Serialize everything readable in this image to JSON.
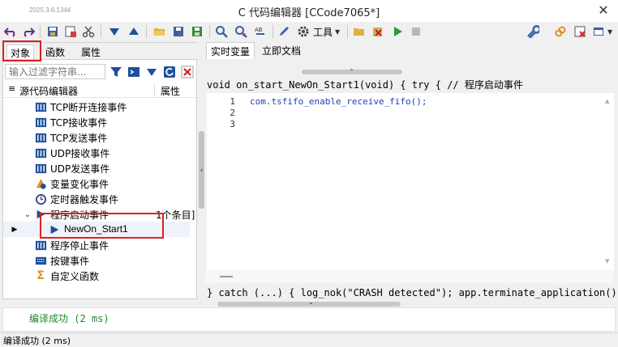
{
  "window": {
    "version": "2025.3.6.1344",
    "title": "C 代码编辑器 [CCode7065*]",
    "close_glyph": "✕"
  },
  "toolbar": {
    "tools_label": "工具",
    "icons": [
      "undo-icon",
      "redo-icon",
      "save-icon",
      "save-as-icon",
      "cut-icon",
      "move-down-icon",
      "move-up-icon",
      "open-folder-icon",
      "export-icon",
      "import-icon",
      "search-icon",
      "replace-icon",
      "format-icon",
      "pen-icon",
      "gear-icon",
      "tools-menu",
      "new-folder-icon",
      "delete-icon",
      "run-icon",
      "stop-icon",
      "wrench-icon",
      "link-icon",
      "close-doc-icon",
      "window-menu"
    ]
  },
  "left_panel": {
    "tabs": [
      "对象",
      "函数",
      "属性"
    ],
    "filter_placeholder": "输入过滤字符串...",
    "tree_header": {
      "name": "源代码编辑器",
      "property": "属性"
    },
    "items": [
      {
        "label": "TCP断开连接事件",
        "icon": "grid-icon"
      },
      {
        "label": "TCP接收事件",
        "icon": "grid-icon"
      },
      {
        "label": "TCP发送事件",
        "icon": "grid-icon"
      },
      {
        "label": "UDP接收事件",
        "icon": "grid-icon"
      },
      {
        "label": "UDP发送事件",
        "icon": "grid-icon"
      },
      {
        "label": "变量变化事件",
        "icon": "variable-icon"
      },
      {
        "label": "定时器触发事件",
        "icon": "clock-icon"
      },
      {
        "label": "程序启动事件",
        "icon": "play-icon",
        "extra": "1个条目]"
      },
      {
        "label": "NewOn_Start1",
        "icon": "play-icon"
      },
      {
        "label": "程序停止事件",
        "icon": "grid-icon"
      },
      {
        "label": "按键事件",
        "icon": "keyboard-icon"
      },
      {
        "label": "自定义函数",
        "icon": "sigma-icon"
      }
    ]
  },
  "right_panel": {
    "tabs": [
      "实时变量",
      "立即文档"
    ],
    "code_header": "void on_start_NewOn_Start1(void) { try { // 程序启动事件",
    "line_numbers": [
      "1",
      "2",
      "3"
    ],
    "code_lines": [
      "com.tsfifo_enable_receive_fifo();"
    ],
    "code_footer": "} catch (...) { log_nok(\"CRASH detected\"); app.terminate_application(); }"
  },
  "output": {
    "text": "编译成功 (2 ms)"
  },
  "status": {
    "text": "编译成功 (2 ms)"
  },
  "colors": {
    "accent_red": "#e02020",
    "code_blue": "#1e3fb0",
    "success_green": "#1f8a2a",
    "icon_blue": "#1e4f9c"
  }
}
